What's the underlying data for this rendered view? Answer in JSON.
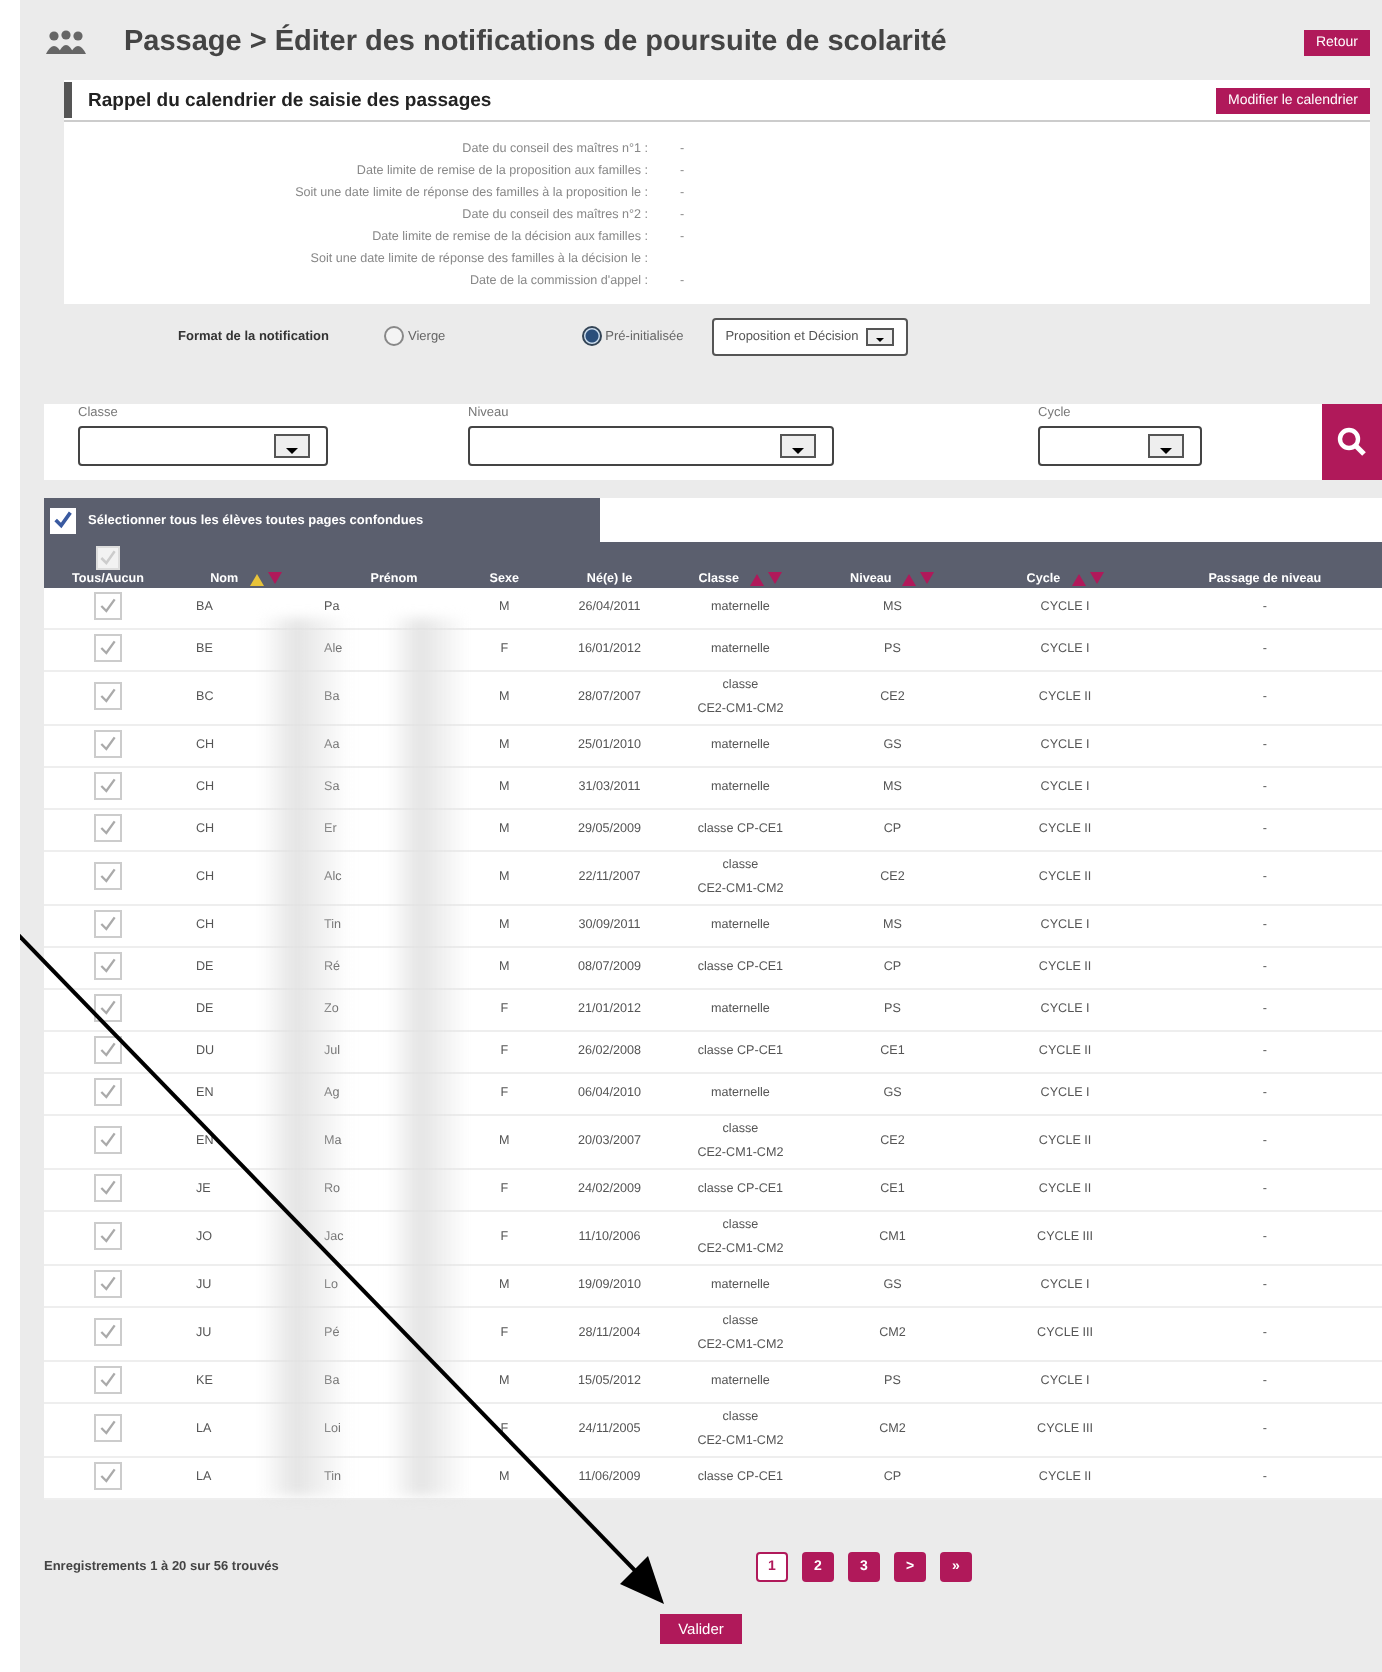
{
  "header": {
    "title": "Passage > Éditer des notifications de poursuite de scolarité",
    "back_button": "Retour"
  },
  "calendar": {
    "title": "Rappel du calendrier de saisie des passages",
    "edit_button": "Modifier le calendrier",
    "rows": [
      {
        "label": "Date du conseil des maîtres n°1 :",
        "value": "-"
      },
      {
        "label": "Date limite de remise de la proposition aux familles :",
        "value": "-"
      },
      {
        "label": "Soit une date limite de réponse des familles à la proposition le :",
        "value": "-"
      },
      {
        "label": "Date du conseil des maîtres n°2 :",
        "value": "-"
      },
      {
        "label": "Date limite de remise de la décision aux familles :",
        "value": "-"
      },
      {
        "label": "Soit une date limite de réponse des familles à la décision le :"
      },
      {
        "label": "Date de la commission d'appel :",
        "value": "-"
      }
    ]
  },
  "format": {
    "label": "Format de la notification",
    "options": [
      {
        "label": "Vierge",
        "selected": false
      },
      {
        "label": "Pré-initialisée",
        "selected": true
      }
    ],
    "select": "Proposition et Décision"
  },
  "filters": [
    {
      "label": "Classe"
    },
    {
      "label": "Niveau"
    },
    {
      "label": "Cycle"
    }
  ],
  "table": {
    "select_all": {
      "label": "Sélectionner tous les élèves toutes pages confondues",
      "checked": true
    },
    "columns": [
      {
        "label": "Tous/Aucun",
        "kind": "checkbox",
        "checked": true
      },
      {
        "label": "Nom",
        "kind": "sortable",
        "sort_up_active": true
      },
      {
        "label": "Prénom",
        "kind": "plain"
      },
      {
        "label": "Sexe",
        "kind": "plain"
      },
      {
        "label": "Né(e) le",
        "kind": "plain"
      },
      {
        "label": "Classe",
        "kind": "sortable",
        "sort_up_active": false
      },
      {
        "label": "Niveau",
        "kind": "sortable",
        "sort_up_active": false
      },
      {
        "label": "Cycle",
        "kind": "sortable",
        "sort_up_active": false
      },
      {
        "label": "Passage de niveau",
        "kind": "plain"
      }
    ],
    "rows": [
      {
        "checked": true,
        "nom": "BA",
        "prenom": "Pa",
        "sexe": "M",
        "date": "26/04/2011",
        "classe": "maternelle",
        "niveau": "MS",
        "cycle": "CYCLE I",
        "passage": "-"
      },
      {
        "checked": true,
        "nom": "BE",
        "prenom": "Ale",
        "sexe": "F",
        "date": "16/01/2012",
        "classe": "maternelle",
        "niveau": "PS",
        "cycle": "CYCLE I",
        "passage": "-"
      },
      {
        "checked": true,
        "nom": "BC",
        "prenom": "Ba",
        "sexe": "M",
        "date": "28/07/2007",
        "classe": "classe CE2-CM1-CM2",
        "niveau": "CE2",
        "cycle": "CYCLE II",
        "passage": "-"
      },
      {
        "checked": true,
        "nom": "CH",
        "prenom": "Aa",
        "sexe": "M",
        "date": "25/01/2010",
        "classe": "maternelle",
        "niveau": "GS",
        "cycle": "CYCLE I",
        "passage": "-"
      },
      {
        "checked": true,
        "nom": "CH",
        "prenom": "Sa",
        "sexe": "M",
        "date": "31/03/2011",
        "classe": "maternelle",
        "niveau": "MS",
        "cycle": "CYCLE I",
        "passage": "-"
      },
      {
        "checked": true,
        "nom": "CH",
        "prenom": "Er",
        "sexe": "M",
        "date": "29/05/2009",
        "classe": "classe CP-CE1",
        "niveau": "CP",
        "cycle": "CYCLE II",
        "passage": "-"
      },
      {
        "checked": true,
        "nom": "CH",
        "prenom": "Alc",
        "sexe": "M",
        "date": "22/11/2007",
        "classe": "classe CE2-CM1-CM2",
        "niveau": "CE2",
        "cycle": "CYCLE II",
        "passage": "-"
      },
      {
        "checked": true,
        "nom": "CH",
        "prenom": "Tin",
        "sexe": "M",
        "date": "30/09/2011",
        "classe": "maternelle",
        "niveau": "MS",
        "cycle": "CYCLE I",
        "passage": "-"
      },
      {
        "checked": true,
        "nom": "DE",
        "prenom": "Ré",
        "sexe": "M",
        "date": "08/07/2009",
        "classe": "classe CP-CE1",
        "niveau": "CP",
        "cycle": "CYCLE II",
        "passage": "-"
      },
      {
        "checked": true,
        "nom": "DE",
        "prenom": "Zo",
        "sexe": "F",
        "date": "21/01/2012",
        "classe": "maternelle",
        "niveau": "PS",
        "cycle": "CYCLE I",
        "passage": "-"
      },
      {
        "checked": true,
        "nom": "DU",
        "prenom": "Jul",
        "sexe": "F",
        "date": "26/02/2008",
        "classe": "classe CP-CE1",
        "niveau": "CE1",
        "cycle": "CYCLE II",
        "passage": "-"
      },
      {
        "checked": true,
        "nom": "EN",
        "prenom": "Ag",
        "sexe": "F",
        "date": "06/04/2010",
        "classe": "maternelle",
        "niveau": "GS",
        "cycle": "CYCLE I",
        "passage": "-"
      },
      {
        "checked": true,
        "nom": "EN",
        "prenom": "Ma",
        "sexe": "M",
        "date": "20/03/2007",
        "classe": "classe CE2-CM1-CM2",
        "niveau": "CE2",
        "cycle": "CYCLE II",
        "passage": "-"
      },
      {
        "checked": true,
        "nom": "JE",
        "prenom": "Ro",
        "sexe": "F",
        "date": "24/02/2009",
        "classe": "classe CP-CE1",
        "niveau": "CE1",
        "cycle": "CYCLE II",
        "passage": "-"
      },
      {
        "checked": true,
        "nom": "JO",
        "prenom": "Jac",
        "sexe": "F",
        "date": "11/10/2006",
        "classe": "classe CE2-CM1-CM2",
        "niveau": "CM1",
        "cycle": "CYCLE III",
        "passage": "-"
      },
      {
        "checked": true,
        "nom": "JU",
        "prenom": "Lo",
        "sexe": "M",
        "date": "19/09/2010",
        "classe": "maternelle",
        "niveau": "GS",
        "cycle": "CYCLE I",
        "passage": "-"
      },
      {
        "checked": true,
        "nom": "JU",
        "prenom": "Pé",
        "sexe": "F",
        "date": "28/11/2004",
        "classe": "classe CE2-CM1-CM2",
        "niveau": "CM2",
        "cycle": "CYCLE III",
        "passage": "-"
      },
      {
        "checked": true,
        "nom": "KE",
        "prenom": "Ba",
        "sexe": "M",
        "date": "15/05/2012",
        "classe": "maternelle",
        "niveau": "PS",
        "cycle": "CYCLE I",
        "passage": "-"
      },
      {
        "checked": true,
        "nom": "LA",
        "prenom": "Loi",
        "sexe": "F",
        "date": "24/11/2005",
        "classe": "classe CE2-CM1-CM2",
        "niveau": "CM2",
        "cycle": "CYCLE III",
        "passage": "-"
      },
      {
        "checked": true,
        "nom": "LA",
        "prenom": "Tin",
        "sexe": "M",
        "date": "11/06/2009",
        "classe": "classe CP-CE1",
        "niveau": "CP",
        "cycle": "CYCLE II",
        "passage": "-"
      }
    ]
  },
  "footer": {
    "count": "Enregistrements 1 à 20 sur 56 trouvés",
    "pages": [
      {
        "label": "1",
        "selected": true
      },
      {
        "label": "2",
        "selected": false
      },
      {
        "label": "3",
        "selected": false
      },
      {
        "label": ">",
        "selected": false
      },
      {
        "label": "»",
        "selected": false
      }
    ],
    "submit": "Valider"
  }
}
